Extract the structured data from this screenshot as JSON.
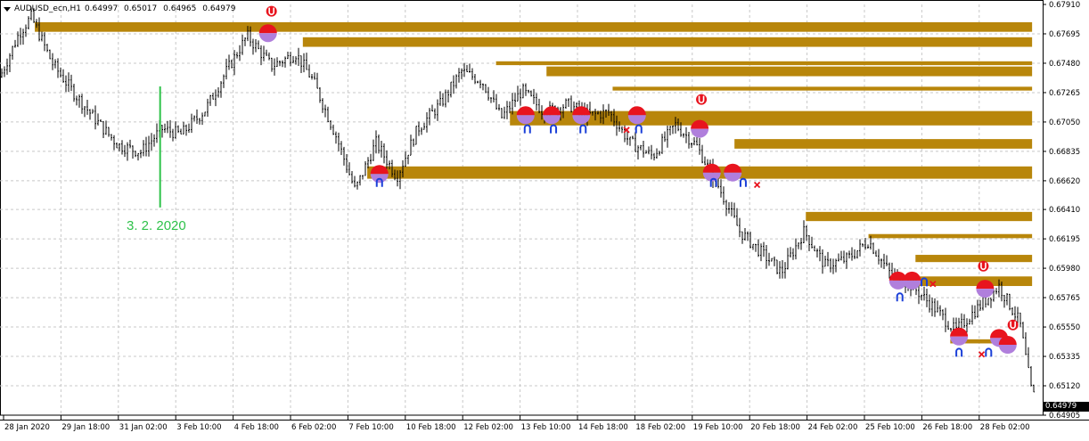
{
  "header": {
    "symbol": "AUDUSD_ecn,H1",
    "open": "0.64997",
    "high": "0.65017",
    "low": "0.64965",
    "close": "0.64979"
  },
  "annotation": {
    "text": "3. 2. 2020",
    "color": "#2ec24a"
  },
  "current_price": "0.64979",
  "colors": {
    "background": "#ffffff",
    "candles": "#000000",
    "zone": "#b8860b",
    "grid": "#c8c8c8",
    "marker_red": "#e8141e",
    "marker_purple": "#b07fdc",
    "arrow_blue": "#1a3fd8",
    "vline": "#2ec24a"
  },
  "chart_data": {
    "type": "candlestick",
    "title": "AUDUSD_ecn,H1",
    "ylim": [
      0.64905,
      0.6791
    ],
    "y_ticks": [
      "0.67910",
      "0.67695",
      "0.67480",
      "0.67265",
      "0.67050",
      "0.66835",
      "0.66620",
      "0.66410",
      "0.66195",
      "0.65980",
      "0.65765",
      "0.65550",
      "0.65335",
      "0.65120",
      "0.64905"
    ],
    "x_ticks": [
      "28 Jan 2020",
      "29 Jan 18:00",
      "31 Jan 02:00",
      "3 Feb 10:00",
      "4 Feb 18:00",
      "6 Feb 02:00",
      "7 Feb 10:00",
      "10 Feb 18:00",
      "12 Feb 02:00",
      "13 Feb 10:00",
      "14 Feb 18:00",
      "18 Feb 02:00",
      "19 Feb 10:00",
      "20 Feb 18:00",
      "24 Feb 02:00",
      "25 Feb 10:00",
      "26 Feb 18:00",
      "28 Feb 02:00"
    ],
    "price_path": [
      [
        0,
        0.6738
      ],
      [
        1.1,
        0.677
      ],
      [
        1.8,
        0.6782
      ],
      [
        3,
        0.6748
      ],
      [
        4.2,
        0.6727
      ],
      [
        5.6,
        0.6705
      ],
      [
        6.8,
        0.6688
      ],
      [
        8.1,
        0.6683
      ],
      [
        9.3,
        0.67
      ],
      [
        10.4,
        0.6696
      ],
      [
        11.8,
        0.6714
      ],
      [
        13.0,
        0.6742
      ],
      [
        14.2,
        0.6768
      ],
      [
        15.6,
        0.6746
      ],
      [
        17.0,
        0.6755
      ],
      [
        18.0,
        0.6735
      ],
      [
        19.3,
        0.6695
      ],
      [
        20.4,
        0.6655
      ],
      [
        21.6,
        0.669
      ],
      [
        22.8,
        0.6665
      ],
      [
        24.0,
        0.67
      ],
      [
        25.3,
        0.6718
      ],
      [
        26.5,
        0.6742
      ],
      [
        27.7,
        0.6735
      ],
      [
        28.8,
        0.6708
      ],
      [
        30.0,
        0.6728
      ],
      [
        31.3,
        0.6712
      ],
      [
        32.6,
        0.6718
      ],
      [
        33.8,
        0.671
      ],
      [
        35.0,
        0.6712
      ],
      [
        36.2,
        0.669
      ],
      [
        37.5,
        0.668
      ],
      [
        38.8,
        0.6703
      ],
      [
        40.0,
        0.6688
      ],
      [
        41.2,
        0.666
      ],
      [
        42.5,
        0.6625
      ],
      [
        43.7,
        0.661
      ],
      [
        44.9,
        0.6595
      ],
      [
        46.2,
        0.6625
      ],
      [
        47.4,
        0.66
      ],
      [
        48.7,
        0.6605
      ],
      [
        49.9,
        0.6618
      ],
      [
        51.1,
        0.6595
      ],
      [
        52.4,
        0.6585
      ],
      [
        53.6,
        0.657
      ],
      [
        54.9,
        0.6552
      ],
      [
        56.1,
        0.6568
      ],
      [
        57.4,
        0.6585
      ],
      [
        58.6,
        0.6558
      ],
      [
        59.3,
        0.6505
      ]
    ],
    "x_range": [
      0,
      59.6
    ],
    "zones": [
      {
        "x0": 2.0,
        "x1": 59.3,
        "y0": 0.6778,
        "y1": 0.6771
      },
      {
        "x0": 17.4,
        "x1": 59.3,
        "y0": 0.6767,
        "y1": 0.676
      },
      {
        "x0": 28.5,
        "x1": 59.3,
        "y0": 0.67494,
        "y1": 0.67466
      },
      {
        "x0": 31.4,
        "x1": 59.3,
        "y0": 0.67456,
        "y1": 0.67385
      },
      {
        "x0": 35.2,
        "x1": 59.3,
        "y0": 0.67308,
        "y1": 0.6728
      },
      {
        "x0": 29.3,
        "x1": 59.3,
        "y0": 0.6713,
        "y1": 0.67025
      },
      {
        "x0": 42.2,
        "x1": 59.3,
        "y0": 0.66925,
        "y1": 0.66855
      },
      {
        "x0": 21.1,
        "x1": 59.3,
        "y0": 0.66725,
        "y1": 0.66635
      },
      {
        "x0": 46.3,
        "x1": 59.3,
        "y0": 0.66392,
        "y1": 0.66325
      },
      {
        "x0": 49.9,
        "x1": 59.3,
        "y0": 0.6623,
        "y1": 0.662
      },
      {
        "x0": 52.6,
        "x1": 59.3,
        "y0": 0.66078,
        "y1": 0.66025
      },
      {
        "x0": 51.3,
        "x1": 59.3,
        "y0": 0.6592,
        "y1": 0.6585
      },
      {
        "x0": 54.6,
        "x1": 57.9,
        "y0": 0.6546,
        "y1": 0.6543
      }
    ],
    "markers": [
      {
        "x": 15.4,
        "y": 0.677,
        "kind": "split"
      },
      {
        "x": 21.8,
        "y": 0.6667,
        "kind": "split"
      },
      {
        "x": 30.2,
        "y": 0.671,
        "kind": "split"
      },
      {
        "x": 31.7,
        "y": 0.671,
        "kind": "split"
      },
      {
        "x": 33.4,
        "y": 0.671,
        "kind": "split"
      },
      {
        "x": 36.6,
        "y": 0.671,
        "kind": "split"
      },
      {
        "x": 40.2,
        "y": 0.67,
        "kind": "split"
      },
      {
        "x": 40.9,
        "y": 0.6668,
        "kind": "split"
      },
      {
        "x": 42.1,
        "y": 0.6668,
        "kind": "split"
      },
      {
        "x": 51.6,
        "y": 0.6589,
        "kind": "split"
      },
      {
        "x": 52.4,
        "y": 0.6589,
        "kind": "split"
      },
      {
        "x": 55.1,
        "y": 0.6548,
        "kind": "split"
      },
      {
        "x": 56.6,
        "y": 0.6583,
        "kind": "split"
      },
      {
        "x": 57.4,
        "y": 0.6547,
        "kind": "split"
      },
      {
        "x": 57.9,
        "y": 0.6542,
        "kind": "split"
      }
    ],
    "arrows_up": [
      {
        "x": 21.8,
        "y": 0.66608
      },
      {
        "x": 30.3,
        "y": 0.67
      },
      {
        "x": 31.8,
        "y": 0.67
      },
      {
        "x": 33.5,
        "y": 0.67
      },
      {
        "x": 36.7,
        "y": 0.67
      },
      {
        "x": 41.0,
        "y": 0.66608
      },
      {
        "x": 42.7,
        "y": 0.66608
      },
      {
        "x": 51.7,
        "y": 0.6577
      },
      {
        "x": 53.1,
        "y": 0.6588
      },
      {
        "x": 55.1,
        "y": 0.65365
      },
      {
        "x": 56.8,
        "y": 0.65365
      }
    ],
    "arrows_down": [
      {
        "x": 15.6,
        "y": 0.6786
      },
      {
        "x": 40.3,
        "y": 0.67215
      },
      {
        "x": 56.5,
        "y": 0.65995
      },
      {
        "x": 58.2,
        "y": 0.65565
      }
    ],
    "crosses": [
      {
        "x": 36.0,
        "y": 0.66992
      },
      {
        "x": 43.5,
        "y": 0.6659
      },
      {
        "x": 53.6,
        "y": 0.65865
      },
      {
        "x": 56.4,
        "y": 0.6535
      }
    ],
    "vline": {
      "x": 9.2,
      "y_top": 0.6731,
      "y_bottom": 0.66425
    }
  }
}
